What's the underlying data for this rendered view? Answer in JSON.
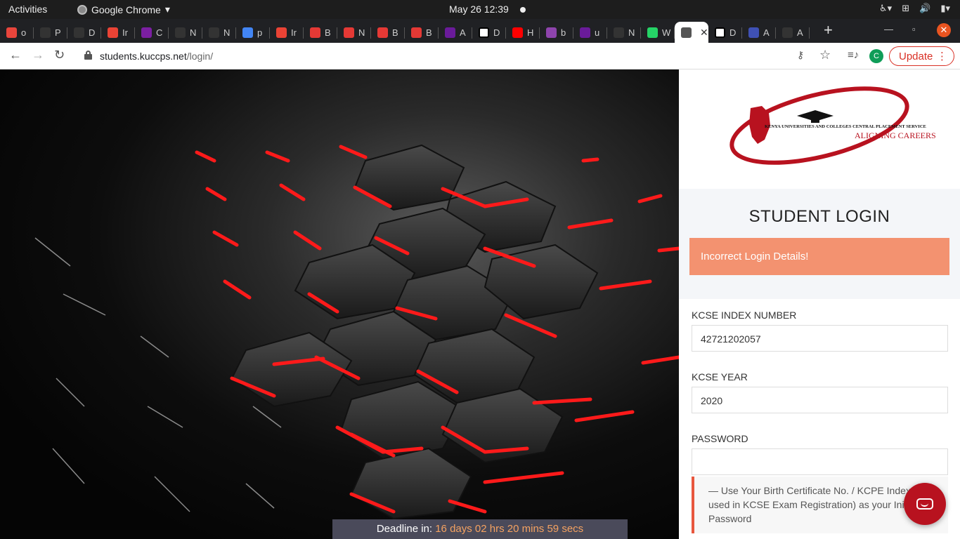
{
  "system_bar": {
    "activities": "Activities",
    "app_name": "Google Chrome",
    "clock": "May 26  12:39"
  },
  "tabs": [
    {
      "title": "o",
      "icon": "tab-favicon",
      "color": "#e8453c"
    },
    {
      "title": "P",
      "icon": "tab-favicon",
      "color": "#333333"
    },
    {
      "title": "D",
      "icon": "tab-favicon",
      "color": "#333333"
    },
    {
      "title": "Ir",
      "icon": "gmail-icon",
      "color": "#ea4335"
    },
    {
      "title": "C",
      "icon": "list-icon",
      "color": "#7b1fa2"
    },
    {
      "title": "N",
      "icon": "tab-favicon",
      "color": "#333333"
    },
    {
      "title": "N",
      "icon": "tab-favicon",
      "color": "#333333"
    },
    {
      "title": "p",
      "icon": "google-icon",
      "color": "#4285f4"
    },
    {
      "title": "Ir",
      "icon": "gmail-icon",
      "color": "#ea4335"
    },
    {
      "title": "B",
      "icon": "play-icon",
      "color": "#e53935"
    },
    {
      "title": "N",
      "icon": "play-icon",
      "color": "#e53935"
    },
    {
      "title": "B",
      "icon": "play-icon",
      "color": "#e53935"
    },
    {
      "title": "B",
      "icon": "play-icon",
      "color": "#e53935"
    },
    {
      "title": "A",
      "icon": "triangle-icon",
      "color": "#6a1b9a"
    },
    {
      "title": "D",
      "icon": "tab-favicon",
      "color": "#ffffff"
    },
    {
      "title": "H",
      "icon": "youtube-icon",
      "color": "#ff0000"
    },
    {
      "title": "b",
      "icon": "tab-favicon",
      "color": "#8e44ad"
    },
    {
      "title": "u",
      "icon": "shield-icon",
      "color": "#6a1b9a"
    },
    {
      "title": "N",
      "icon": "tab-favicon",
      "color": "#333333"
    },
    {
      "title": "W",
      "icon": "whatsapp-icon",
      "color": "#25d366"
    },
    {
      "title": "",
      "icon": "globe-icon",
      "color": "#555555",
      "active": true
    },
    {
      "title": "D",
      "icon": "tab-favicon",
      "color": "#ffffff"
    },
    {
      "title": "A",
      "icon": "gear-icon",
      "color": "#3f51b5"
    },
    {
      "title": "A",
      "icon": "tab-favicon",
      "color": "#333333"
    }
  ],
  "omnibox": {
    "url_host": "students.kuccps.net",
    "url_path": "/login/",
    "profile_initial": "C",
    "update_label": "Update"
  },
  "page": {
    "logo_text": "KENYA UNIVERSITIES AND COLLEGES CENTRAL PLACEMENT SERVICE",
    "logo_tagline": "ALIGNING CAREERS",
    "login_title": "STUDENT LOGIN",
    "alert": "Incorrect Login Details!",
    "index_label": "KCSE INDEX NUMBER",
    "index_value": "42721202057",
    "year_label": "KCSE YEAR",
    "year_value": "2020",
    "password_label": "PASSWORD",
    "password_value": "",
    "hint": "— Use Your Birth Certificate No. / KCPE Index (as used in KCSE Exam Registration) as your Initial Password",
    "deadline_label": "Deadline in:",
    "deadline_value": "16 days 02 hrs 20 mins 59 secs"
  },
  "colors": {
    "brand_red": "#b8121f",
    "alert_bg": "#f39270",
    "accent_orange": "#f4a261"
  }
}
